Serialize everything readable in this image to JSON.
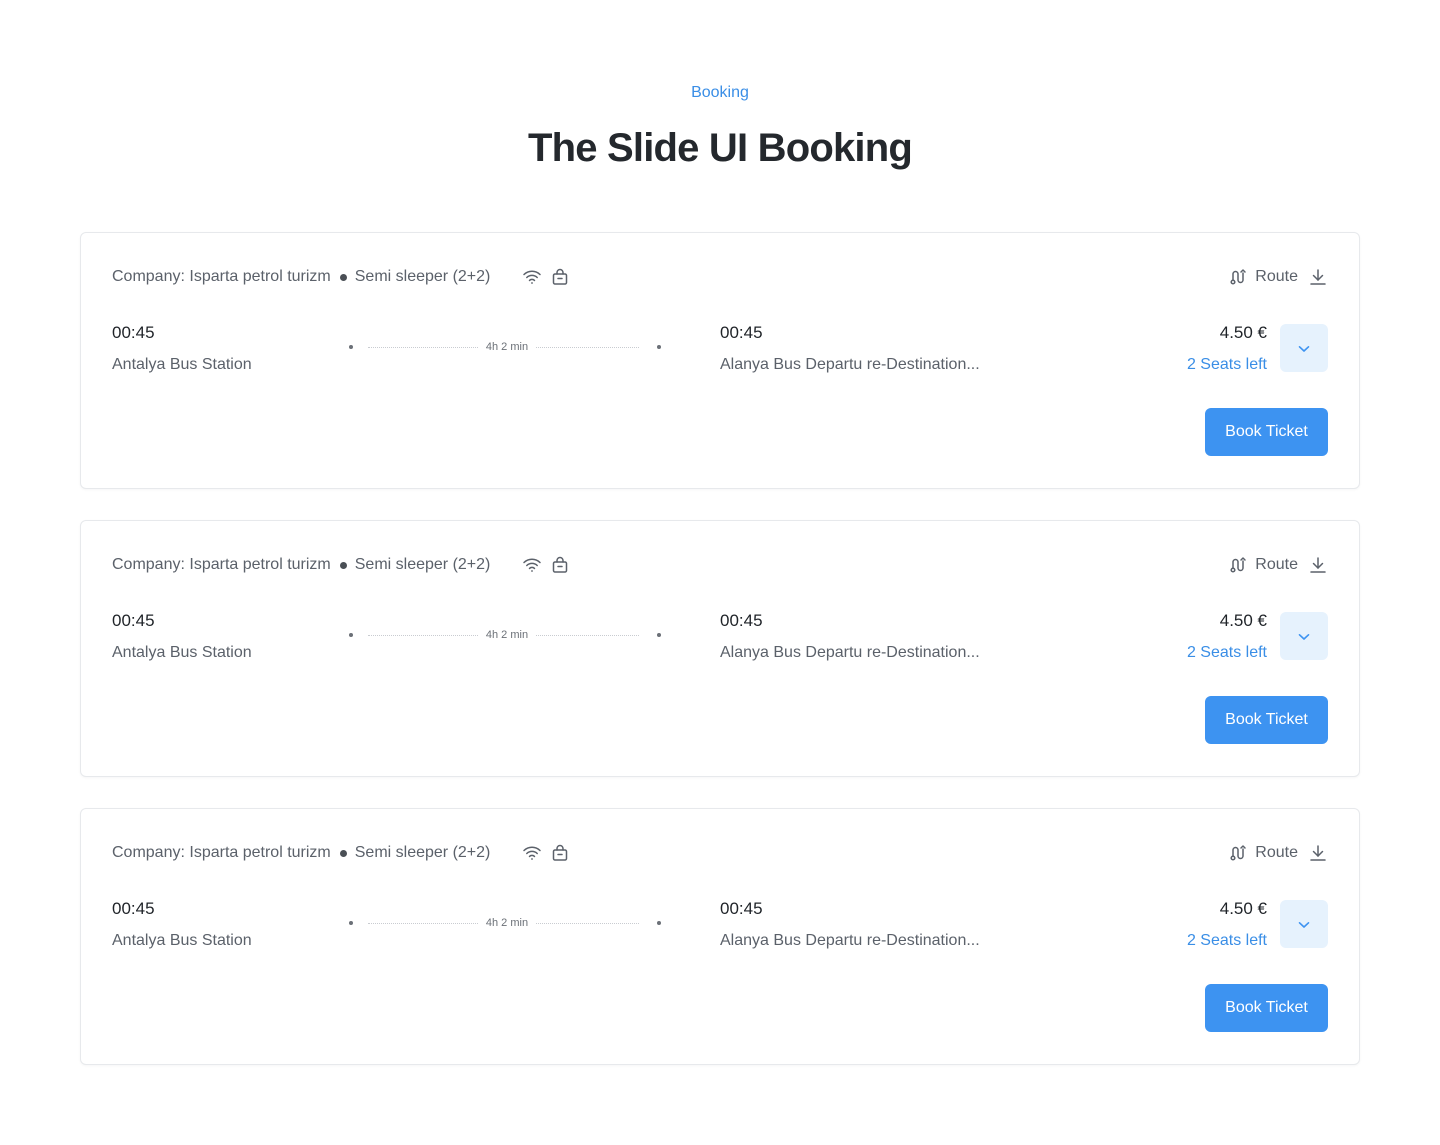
{
  "header": {
    "eyebrow": "Booking",
    "title": "The Slide UI Booking"
  },
  "colors": {
    "accent": "#3d93f1",
    "accent_text": "#3a8ee6",
    "expand_bg": "#e6f2fd"
  },
  "icons": {
    "amenities": [
      "wifi-icon",
      "luggage-icon"
    ],
    "route": "route-icon",
    "download": "download-icon",
    "expand": "chevron-down-icon"
  },
  "trips": [
    {
      "company": "Company: Isparta petrol turizm",
      "bus_type": "Semi sleeper (2+2)",
      "route_label": "Route",
      "departure_time": "00:45",
      "departure_station": "Antalya Bus Station",
      "duration": "4h 2 min",
      "arrival_time": "00:45",
      "arrival_station": "Alanya Bus Departu re-Destination...",
      "price": "4.50 €",
      "seats_left": "2 Seats left",
      "book_label": "Book Ticket"
    },
    {
      "company": "Company: Isparta petrol turizm",
      "bus_type": "Semi sleeper (2+2)",
      "route_label": "Route",
      "departure_time": "00:45",
      "departure_station": "Antalya Bus Station",
      "duration": "4h 2 min",
      "arrival_time": "00:45",
      "arrival_station": "Alanya Bus Departu re-Destination...",
      "price": "4.50 €",
      "seats_left": "2 Seats left",
      "book_label": "Book Ticket"
    },
    {
      "company": "Company: Isparta petrol turizm",
      "bus_type": "Semi sleeper (2+2)",
      "route_label": "Route",
      "departure_time": "00:45",
      "departure_station": "Antalya Bus Station",
      "duration": "4h 2 min",
      "arrival_time": "00:45",
      "arrival_station": "Alanya Bus Departu re-Destination...",
      "price": "4.50 €",
      "seats_left": "2 Seats left",
      "book_label": "Book Ticket"
    }
  ]
}
